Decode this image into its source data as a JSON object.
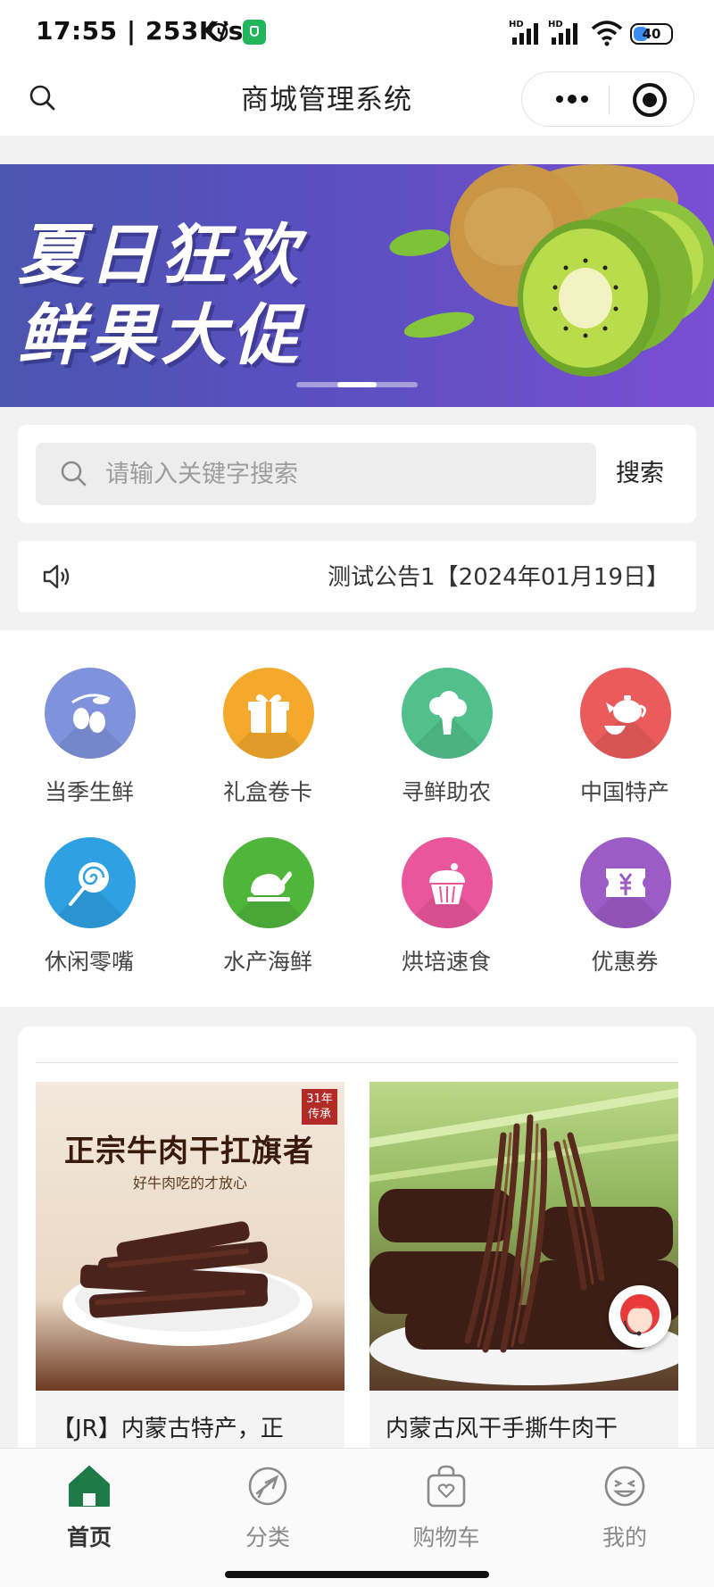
{
  "status_bar": {
    "time": "17:55",
    "speed": "253K/s",
    "signal1": "HD",
    "signal2": "HD",
    "battery": "40",
    "battery_level": 0.4
  },
  "nav": {
    "title": "商城管理系统"
  },
  "banner": {
    "line1": "夏日狂欢",
    "line2": "鲜果大促",
    "slide_count": 3,
    "active_slide": 2
  },
  "search": {
    "placeholder": "请输入关键字搜索",
    "button": "搜索"
  },
  "notice": {
    "text": "测试公告1【2024年01月19日】"
  },
  "categories": [
    {
      "label": "当季生鲜",
      "icon": "olive-icon",
      "color": "#7a8fd8"
    },
    {
      "label": "礼盒卷卡",
      "icon": "gift-icon",
      "color": "#f3a92a"
    },
    {
      "label": "寻鲜助农",
      "icon": "broccoli-icon",
      "color": "#4fbf86"
    },
    {
      "label": "中国特产",
      "icon": "teapot-icon",
      "color": "#e85a5a"
    },
    {
      "label": "休闲零嘴",
      "icon": "lollipop-icon",
      "color": "#2d9de0"
    },
    {
      "label": "水产海鲜",
      "icon": "chicken-icon",
      "color": "#4bb43a"
    },
    {
      "label": "烘培速食",
      "icon": "cupcake-icon",
      "color": "#e8549a"
    },
    {
      "label": "优惠券",
      "icon": "coupon-icon",
      "color": "#9b5bc4"
    }
  ],
  "products": [
    {
      "title": "【JR】内蒙古特产，正",
      "poster_title": "正宗牛肉干扛旗者",
      "poster_sub": "好牛肉吃的才放心",
      "badge_line1": "31年",
      "badge_line2": "传承"
    },
    {
      "title": "内蒙古风干手撕牛肉干"
    }
  ],
  "tabs": [
    {
      "label": "首页",
      "icon": "home-icon",
      "active": true
    },
    {
      "label": "分类",
      "icon": "category-icon",
      "active": false
    },
    {
      "label": "购物车",
      "icon": "cart-icon",
      "active": false
    },
    {
      "label": "我的",
      "icon": "profile-icon",
      "active": false
    }
  ],
  "colors": {
    "accent": "#1f7a4a",
    "banner": "#5a4fc0"
  }
}
